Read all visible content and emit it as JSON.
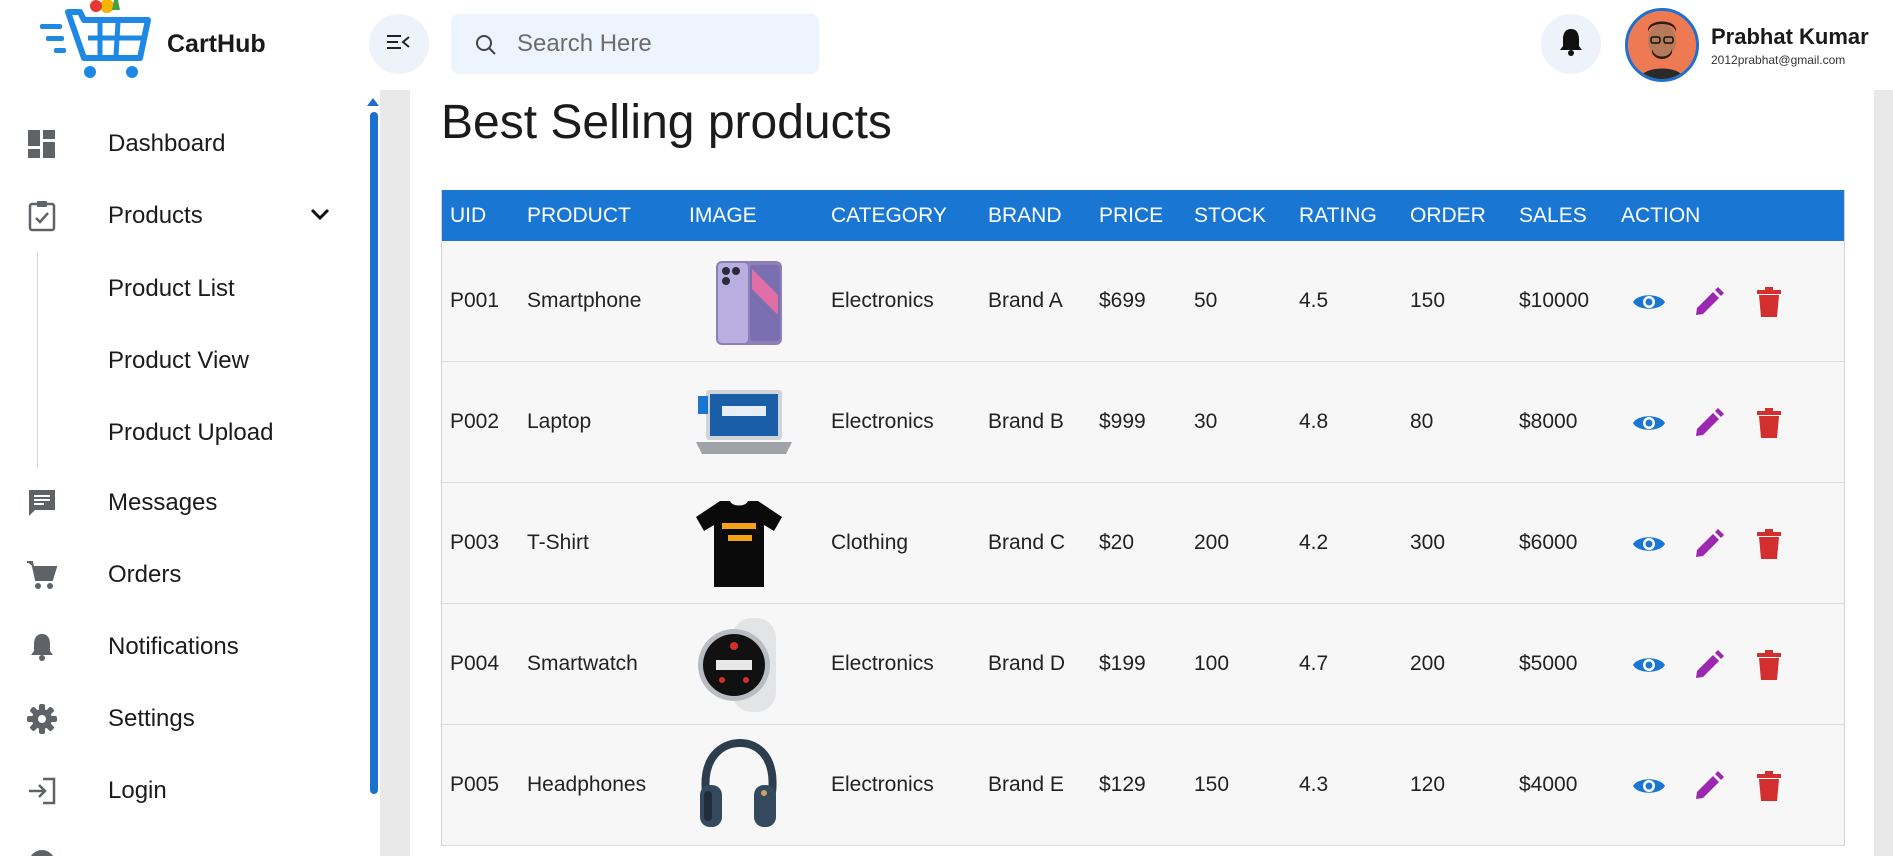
{
  "app": {
    "name": "CartHub"
  },
  "search": {
    "placeholder": "Search Here"
  },
  "user": {
    "name": "Prabhat Kumar",
    "email": "2012prabhat@gmail.com"
  },
  "sidebar": {
    "items": [
      {
        "label": "Dashboard",
        "icon": "dashboard-icon"
      },
      {
        "label": "Products",
        "icon": "clipboard-check-icon",
        "expanded": true,
        "children": [
          "Product List",
          "Product View",
          "Product Upload"
        ]
      },
      {
        "label": "Messages",
        "icon": "message-icon"
      },
      {
        "label": "Orders",
        "icon": "cart-icon"
      },
      {
        "label": "Notifications",
        "icon": "bell-icon"
      },
      {
        "label": "Settings",
        "icon": "gear-icon"
      },
      {
        "label": "Login",
        "icon": "login-icon"
      }
    ]
  },
  "main": {
    "title": "Best Selling products",
    "table": {
      "columns": [
        "UID",
        "PRODUCT",
        "IMAGE",
        "CATEGORY",
        "BRAND",
        "PRICE",
        "STOCK",
        "RATING",
        "ORDER",
        "SALES",
        "ACTION"
      ],
      "rows": [
        {
          "uid": "P001",
          "product": "Smartphone",
          "image": "smartphone-image",
          "category": "Electronics",
          "brand": "Brand A",
          "price": "$699",
          "stock": "50",
          "rating": "4.5",
          "order": "150",
          "sales": "$10000"
        },
        {
          "uid": "P002",
          "product": "Laptop",
          "image": "laptop-image",
          "category": "Electronics",
          "brand": "Brand B",
          "price": "$999",
          "stock": "30",
          "rating": "4.8",
          "order": "80",
          "sales": "$8000"
        },
        {
          "uid": "P003",
          "product": "T-Shirt",
          "image": "tshirt-image",
          "category": "Clothing",
          "brand": "Brand C",
          "price": "$20",
          "stock": "200",
          "rating": "4.2",
          "order": "300",
          "sales": "$6000"
        },
        {
          "uid": "P004",
          "product": "Smartwatch",
          "image": "smartwatch-image",
          "category": "Electronics",
          "brand": "Brand D",
          "price": "$199",
          "stock": "100",
          "rating": "4.7",
          "order": "200",
          "sales": "$5000"
        },
        {
          "uid": "P005",
          "product": "Headphones",
          "image": "headphones-image",
          "category": "Electronics",
          "brand": "Brand E",
          "price": "$129",
          "stock": "150",
          "rating": "4.3",
          "order": "120",
          "sales": "$4000"
        }
      ],
      "action_colors": {
        "view": "#1976d2",
        "edit": "#9c27b0",
        "delete": "#d32f2f"
      }
    }
  },
  "colors": {
    "accent": "#1976d2",
    "header_bg": "#1976d2"
  }
}
